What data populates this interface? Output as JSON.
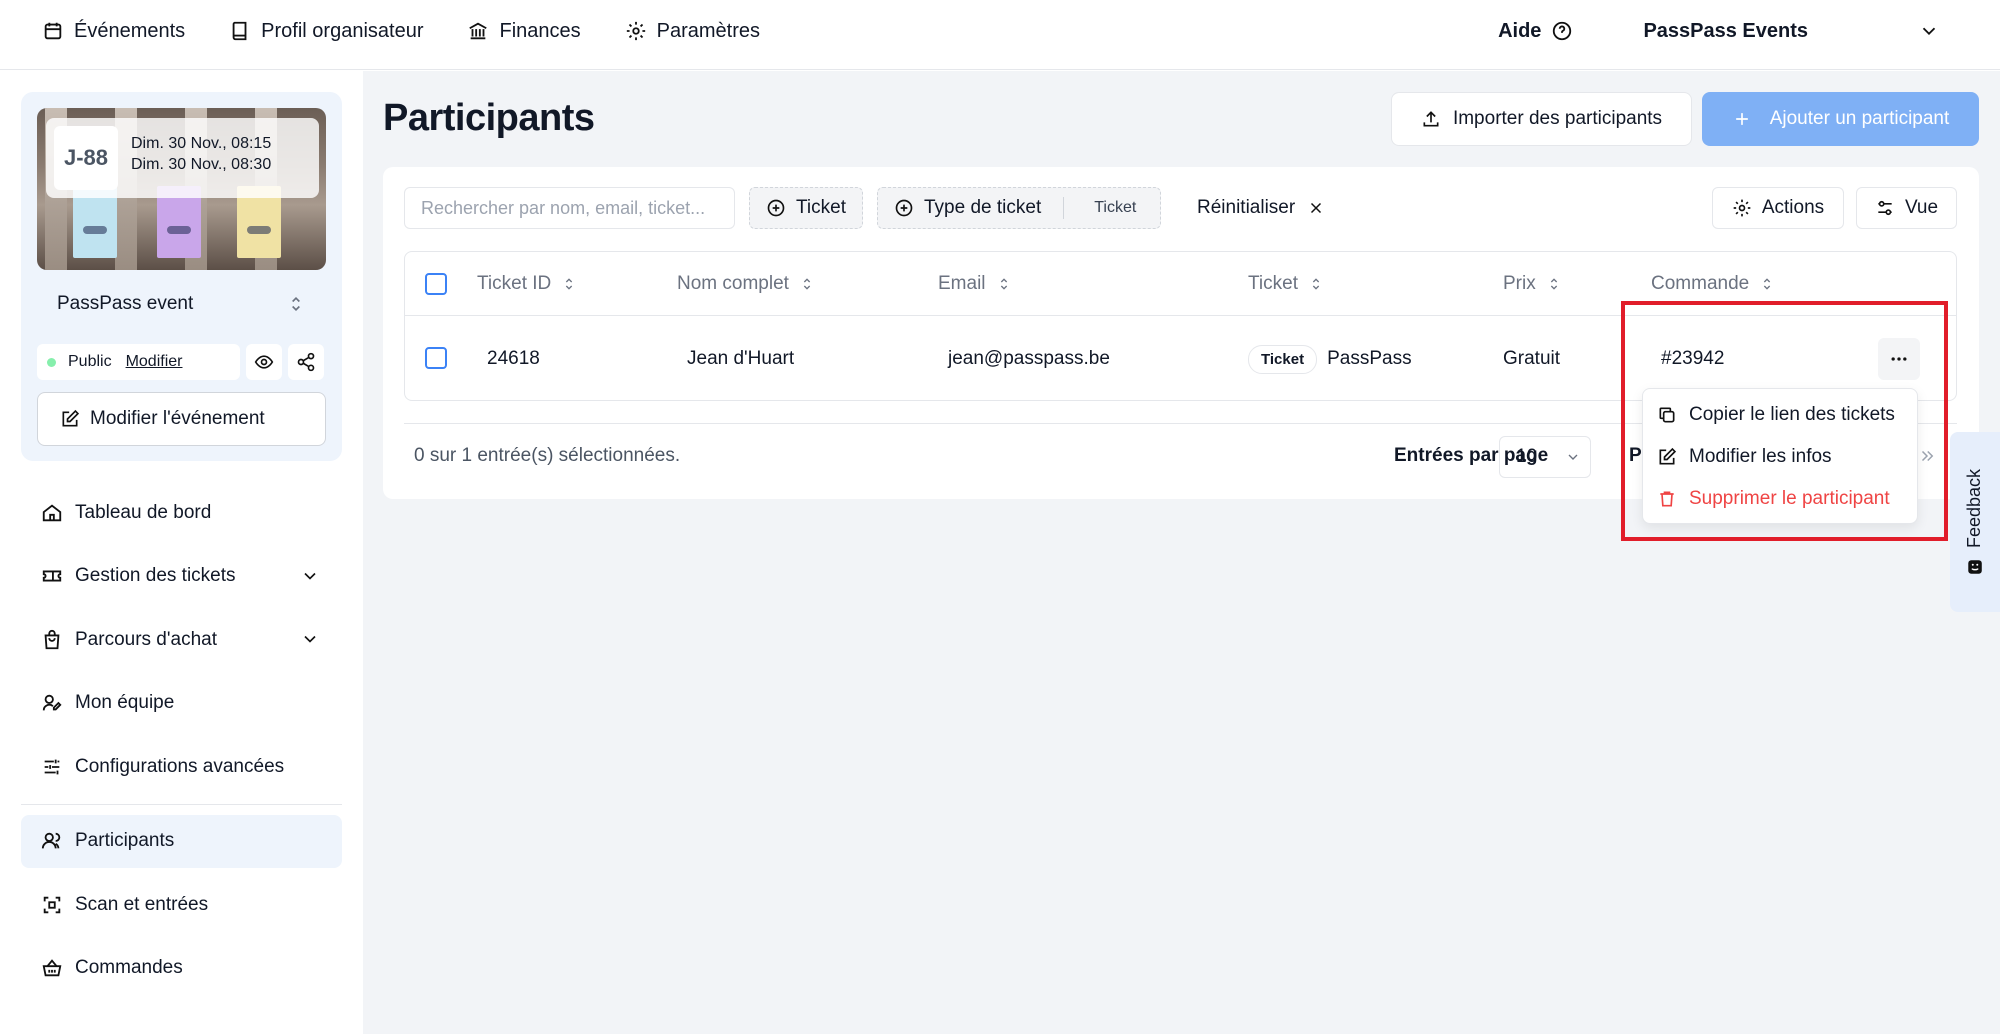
{
  "topnav": {
    "items": [
      {
        "label": "Événements",
        "icon": "calendar-icon"
      },
      {
        "label": "Profil organisateur",
        "icon": "book-icon"
      },
      {
        "label": "Finances",
        "icon": "bank-icon"
      },
      {
        "label": "Paramètres",
        "icon": "gear-icon"
      }
    ],
    "help_label": "Aide",
    "org_name": "PassPass Events"
  },
  "event": {
    "countdown": "J-88",
    "date_start": "Dim. 30 Nov., 08:15",
    "date_end": "Dim. 30 Nov., 08:30",
    "name": "PassPass event",
    "visibility": "Public",
    "modify_link": "Modifier",
    "edit_button": "Modifier l'événement"
  },
  "sidebar": {
    "items": [
      {
        "label": "Tableau de bord",
        "icon": "home-icon"
      },
      {
        "label": "Gestion des tickets",
        "icon": "ticket-icon"
      },
      {
        "label": "Parcours d'achat",
        "icon": "bag-icon"
      },
      {
        "label": "Mon équipe",
        "icon": "user-edit-icon"
      },
      {
        "label": "Configurations avancées",
        "icon": "sliders-icon"
      },
      {
        "label": "Participants",
        "icon": "users-icon"
      },
      {
        "label": "Scan et entrées",
        "icon": "scan-icon"
      },
      {
        "label": "Commandes",
        "icon": "basket-icon"
      }
    ]
  },
  "main": {
    "title": "Participants",
    "import_button": "Importer des participants",
    "add_button": "Ajouter un participant",
    "search_placeholder": "Rechercher par nom, email, ticket...",
    "filter_ticket": "Ticket",
    "filter_ticket_type": "Type de ticket",
    "filter_ticket_type_value": "Ticket",
    "reset_label": "Réinitialiser",
    "actions_button": "Actions",
    "view_button": "Vue"
  },
  "table": {
    "columns": [
      "Ticket ID",
      "Nom complet",
      "Email",
      "Ticket",
      "Prix",
      "Commande"
    ],
    "rows": [
      {
        "ticket_id": "24618",
        "name": "Jean d'Huart",
        "email": "jean@passpass.be",
        "ticket_tag": "Ticket",
        "ticket_name": "PassPass",
        "price": "Gratuit",
        "order": "#23942"
      }
    ]
  },
  "footer": {
    "selected_text": "0 sur 1 entrée(s) sélectionnées.",
    "per_page_label": "Entrées par page",
    "per_page_value": "10",
    "page_label_partial": "P"
  },
  "row_menu": {
    "items": [
      {
        "label": "Copier le lien des tickets",
        "icon": "copy-icon"
      },
      {
        "label": "Modifier les infos",
        "icon": "edit-icon"
      },
      {
        "label": "Supprimer le participant",
        "icon": "trash-icon"
      }
    ]
  },
  "feedback_label": "Feedback",
  "colors": {
    "accent": "#7fb0f5",
    "danger": "#ef4444",
    "highlight": "#e11d2a",
    "active_bg": "#eef4fc"
  }
}
